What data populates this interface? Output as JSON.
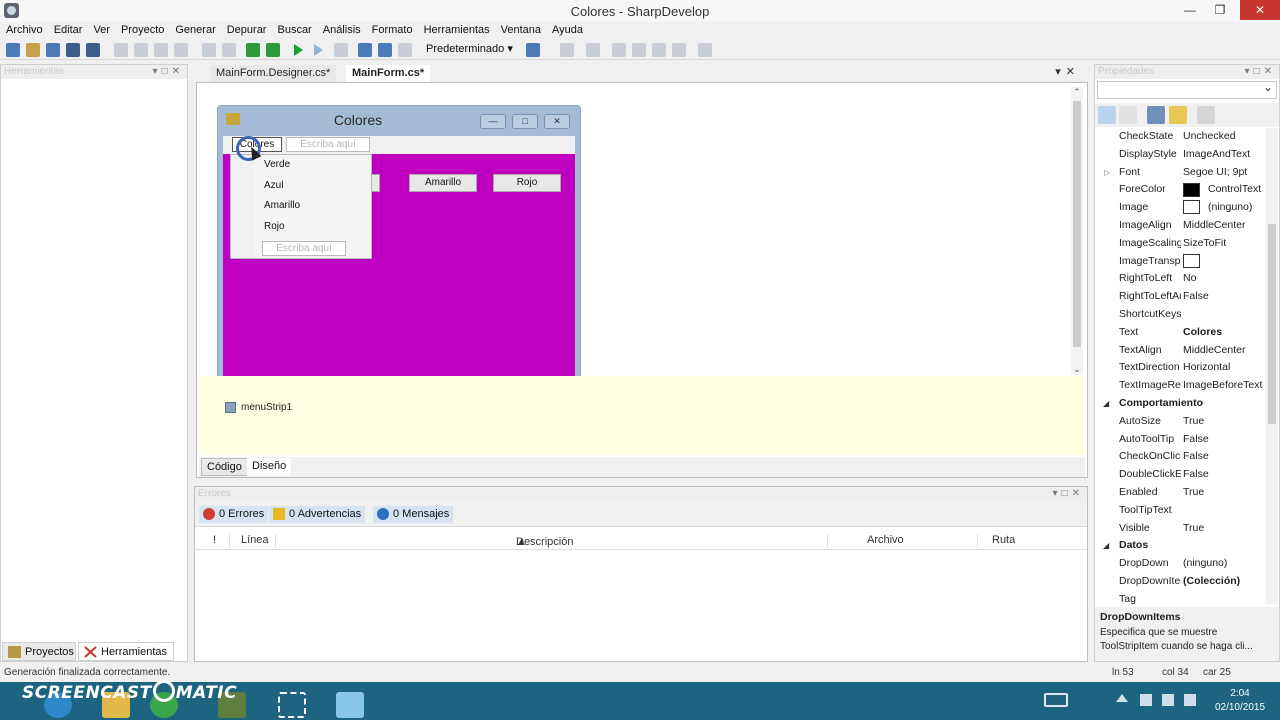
{
  "window": {
    "title": "Colores - SharpDevelop"
  },
  "menubar": [
    "Archivo",
    "Editar",
    "Ver",
    "Proyecto",
    "Generar",
    "Depurar",
    "Buscar",
    "Análisis",
    "Formato",
    "Herramientas",
    "Ventana",
    "Ayuda"
  ],
  "toolbar": {
    "config": "Predeterminado"
  },
  "left_panel": {
    "title": "Herramientas",
    "tab_projects": "Proyectos",
    "tab_tools": "Herramientas"
  },
  "doc_tabs": [
    "MainForm.Designer.cs*",
    "MainForm.cs*"
  ],
  "designer": {
    "form_title": "Colores",
    "menu_item": "Colores",
    "type_here": "Escriba aquí",
    "dropdown_items": [
      "Verde",
      "Azul",
      "Amarillo",
      "Rojo"
    ],
    "buttons": [
      "Amarillo",
      "Rojo"
    ],
    "form_color": "#c000c0",
    "tray_component": "menuStrip1"
  },
  "view_tabs": [
    "Código",
    "Diseño"
  ],
  "errors": {
    "title": "Errores",
    "filters": {
      "errors": "0 Errores",
      "warnings": "0 Advertencias",
      "messages": "0 Mensajes"
    },
    "columns": [
      "!",
      "Línea",
      "Descripción",
      "Archivo",
      "Ruta"
    ]
  },
  "properties": {
    "title": "Propiedades",
    "rows": [
      {
        "name": "CheckState",
        "value": "Unchecked"
      },
      {
        "name": "DisplayStyle",
        "value": "ImageAndText"
      },
      {
        "name": "Font",
        "value": "Segoe UI; 9pt",
        "expandable": true
      },
      {
        "name": "ForeColor",
        "value": "ControlText",
        "swatch": "#000000"
      },
      {
        "name": "Image",
        "value": "(ninguno)",
        "swatch": "#ffffff"
      },
      {
        "name": "ImageAlign",
        "value": "MiddleCenter"
      },
      {
        "name": "ImageScaling",
        "value": "SizeToFit"
      },
      {
        "name": "ImageTransparentColor",
        "value": "",
        "swatch": "#ffffff"
      },
      {
        "name": "RightToLeft",
        "value": "No"
      },
      {
        "name": "RightToLeftAutoMirrorImage",
        "value": "False"
      },
      {
        "name": "ShortcutKeys",
        "value": ""
      },
      {
        "name": "Text",
        "value": "Colores",
        "bold": true
      },
      {
        "name": "TextAlign",
        "value": "MiddleCenter"
      },
      {
        "name": "TextDirection",
        "value": "Horizontal"
      },
      {
        "name": "TextImageRelation",
        "value": "ImageBeforeText"
      },
      {
        "category": "Comportamiento"
      },
      {
        "name": "AutoSize",
        "value": "True"
      },
      {
        "name": "AutoToolTip",
        "value": "False"
      },
      {
        "name": "CheckOnClick",
        "value": "False"
      },
      {
        "name": "DoubleClickEnabled",
        "value": "False"
      },
      {
        "name": "Enabled",
        "value": "True"
      },
      {
        "name": "ToolTipText",
        "value": ""
      },
      {
        "name": "Visible",
        "value": "True"
      },
      {
        "category": "Datos"
      },
      {
        "name": "DropDown",
        "value": "(ninguno)"
      },
      {
        "name": "DropDownItems",
        "value": "(Colección)",
        "bold": true
      },
      {
        "name": "Tag",
        "value": ""
      }
    ],
    "desc_title": "DropDownItems",
    "desc_text": "Especifica que se muestre ToolStripItem cuando se haga cli..."
  },
  "status": {
    "message": "Generación finalizada correctamente.",
    "ln": "ln 53",
    "col": "col 34",
    "car": "car 25"
  },
  "taskbar": {
    "logo_left": "SCREENCAST",
    "logo_right": "MATIC",
    "time": "2:04",
    "date": "02/10/2015"
  }
}
